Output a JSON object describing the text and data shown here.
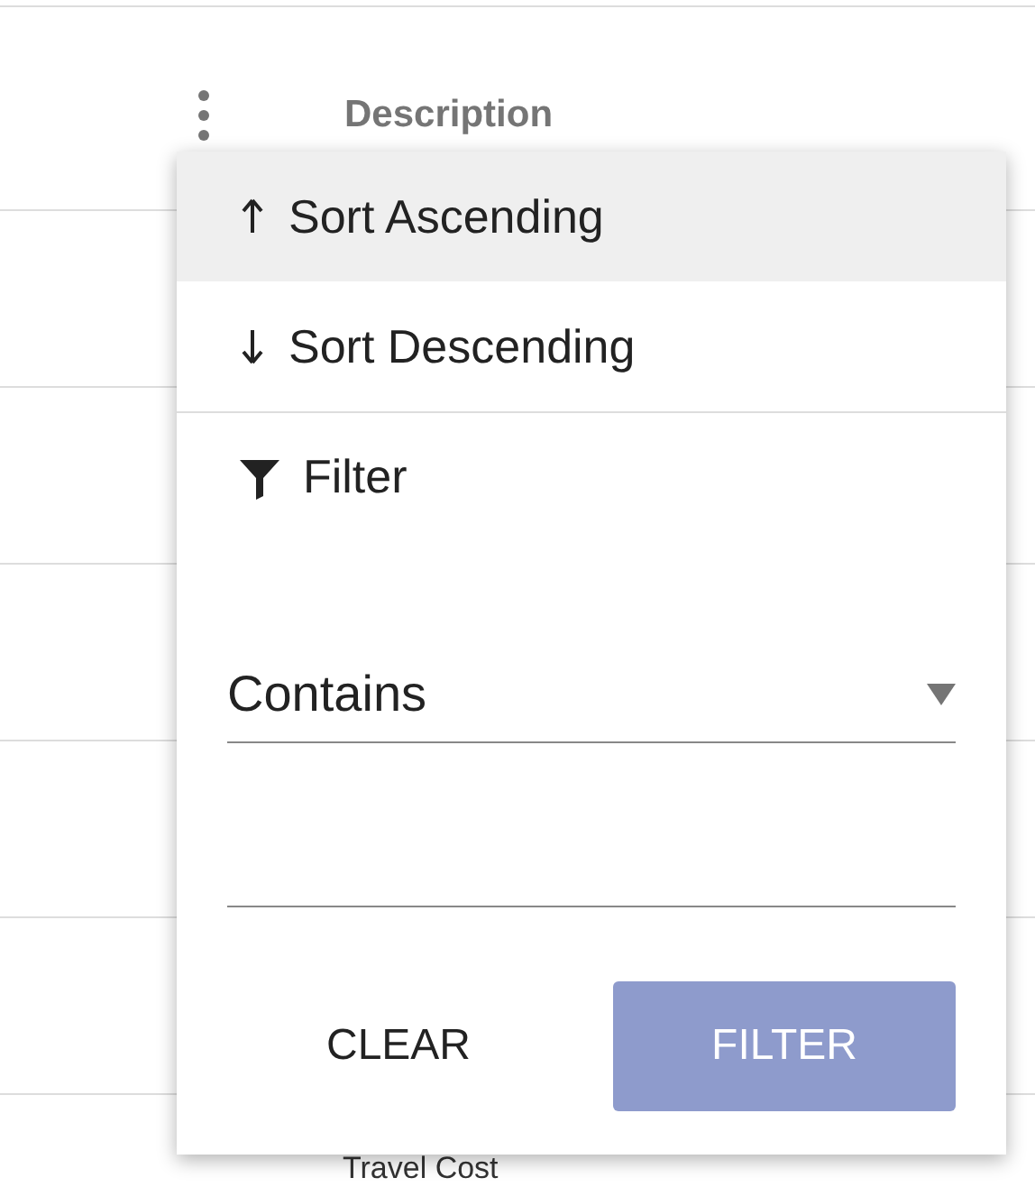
{
  "header": {
    "column_title": "Description"
  },
  "last_row": {
    "cell": "Travel Cost"
  },
  "menu": {
    "sort_items": [
      {
        "kind": "ascending",
        "label": "Sort Ascending",
        "selected": true
      },
      {
        "kind": "descending",
        "label": "Sort Descending",
        "selected": false
      }
    ],
    "filter": {
      "label": "Filter",
      "operator": "Contains",
      "buttons": [
        {
          "kind": "text",
          "label": "CLEAR"
        },
        {
          "kind": "filled",
          "label": "FILTER"
        }
      ]
    }
  }
}
